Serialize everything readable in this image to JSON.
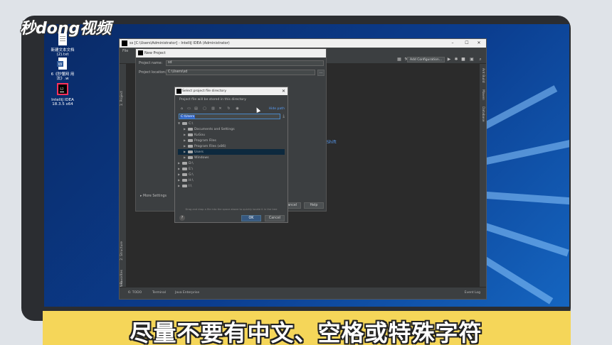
{
  "overlay": {
    "logo": "秒dong视频",
    "subtitle": "尽量不要有中文、空格或特殊字符"
  },
  "desktop_icons": [
    {
      "icon": "text-file-icon",
      "label": "新建文本文档 (2).txt"
    },
    {
      "icon": "word-document-icon",
      "label": "6《秒懂网 用法》.w"
    },
    {
      "icon": "intellij-idea-icon",
      "label": "IntelliJ IDEA 18.3.5 x64"
    }
  ],
  "ide": {
    "title": "ss [C:\\Users\\Administrator] - IntelliJ IDEA (Administrator)",
    "menu": "File",
    "add_configuration": "Add Configuration...",
    "left_tabs": [
      "1: Project",
      "2: Structure",
      "2: Favorites",
      "Web"
    ],
    "right_tabs": [
      "Ant Build",
      "Maven",
      "Database"
    ],
    "hint_text": "Shift",
    "status_items": [
      "6: TODO",
      "Terminal",
      "Java Enterprise",
      "Event Log"
    ]
  },
  "new_project": {
    "title": "New Project",
    "project_name_label": "Project name:",
    "project_name_value": "sd",
    "project_location_label": "Project location:",
    "project_location_value": "C:\\Users\\sd",
    "browse_label": "...",
    "more_settings": "More Settings",
    "cancel_label": "Cancel",
    "help_label": "Help"
  },
  "select_dir": {
    "title": "Select project file directory",
    "subtitle": "Project file will be stored in this directory",
    "hide_path": "Hide path",
    "path_value": "C:\\Users",
    "tree": [
      {
        "label": "C:\\",
        "level": 0,
        "expanded": true
      },
      {
        "label": "Documents and Settings",
        "level": 1
      },
      {
        "label": "KuGou",
        "level": 1
      },
      {
        "label": "Program Files",
        "level": 1
      },
      {
        "label": "Program Files (x86)",
        "level": 1
      },
      {
        "label": "Users",
        "level": 1,
        "selected": true
      },
      {
        "label": "Windows",
        "level": 1
      },
      {
        "label": "D:\\",
        "level": 0
      },
      {
        "label": "E:\\",
        "level": 0
      },
      {
        "label": "G:\\",
        "level": 0
      },
      {
        "label": "H:\\",
        "level": 0
      },
      {
        "label": "I:\\",
        "level": 0
      }
    ],
    "drag_hint": "Drag and drop a file into the space above to quickly locate it in the tree",
    "help_label": "?",
    "ok_label": "OK",
    "cancel_label": "Cancel"
  }
}
